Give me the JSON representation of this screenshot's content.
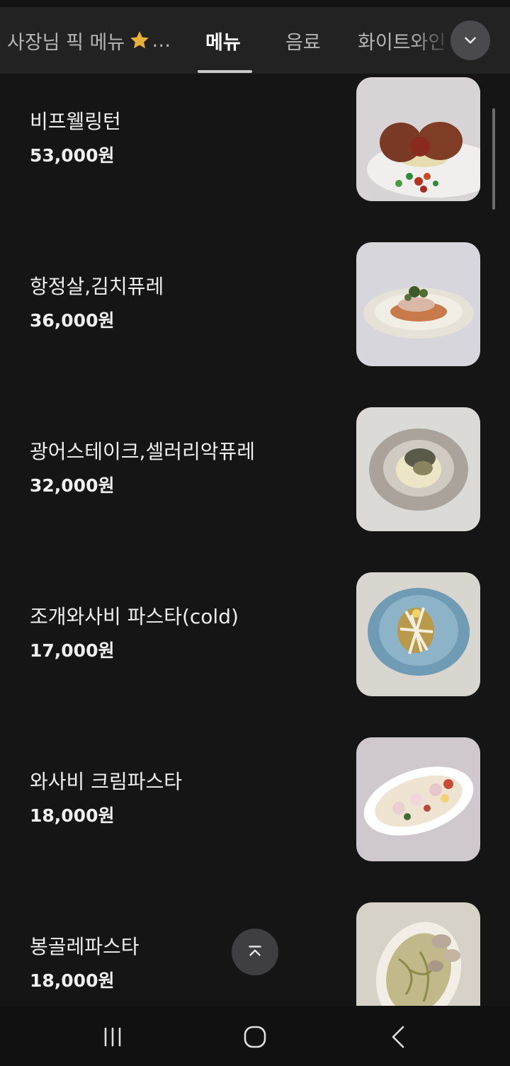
{
  "tabs": [
    {
      "label": "사장님 픽 메뉴",
      "suffix": "…",
      "icon": "star-icon",
      "active": false
    },
    {
      "label": "메뉴",
      "active": true
    },
    {
      "label": "음료",
      "active": false
    },
    {
      "label": "화이트와인",
      "active": false
    }
  ],
  "items": [
    {
      "name": "비프웰링턴",
      "price": "53,000원"
    },
    {
      "name": "항정살,김치퓨레",
      "price": "36,000원"
    },
    {
      "name": "광어스테이크,셀러리악퓨레",
      "price": "32,000원"
    },
    {
      "name": "조개와사비 파스타(cold)",
      "price": "17,000원"
    },
    {
      "name": "와사비 크림파스타",
      "price": "18,000원"
    },
    {
      "name": "봉골레파스타",
      "price": "18,000원"
    }
  ],
  "icons": {
    "expand": "chevron-down-icon",
    "scroll_top": "scroll-to-top-icon",
    "nav_recents": "recent-apps-icon",
    "nav_home": "home-icon",
    "nav_back": "back-icon"
  },
  "colors": {
    "background": "#151516",
    "tab_bar": "#222223",
    "active_tab": "#ffffff",
    "inactive_tab": "#b5b5b5",
    "star": "#e8b23a"
  }
}
